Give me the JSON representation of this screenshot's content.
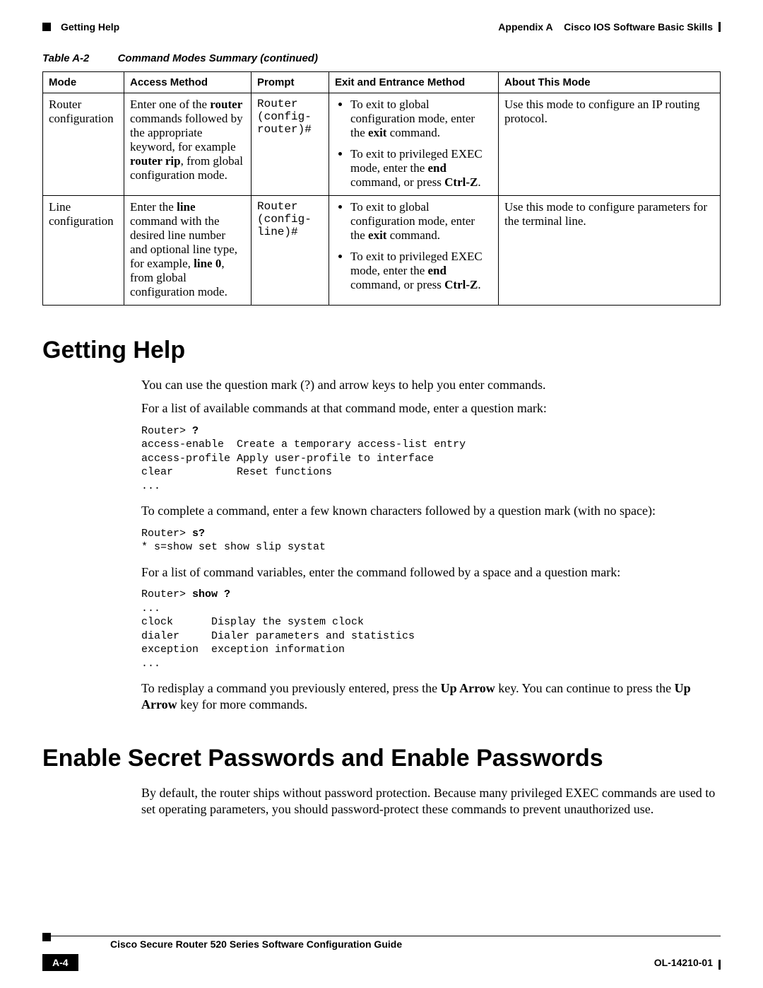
{
  "header": {
    "section_title": "Getting Help",
    "appendix_label": "Appendix A",
    "appendix_title": "Cisco IOS Software Basic Skills"
  },
  "table": {
    "label": "Table A-2",
    "caption": "Command Modes Summary (continued)",
    "headers": {
      "mode": "Mode",
      "access": "Access Method",
      "prompt": "Prompt",
      "exit": "Exit and Entrance Method",
      "about": "About This Mode"
    },
    "rows": [
      {
        "mode": "Router configuration",
        "access_pre": "Enter one of the ",
        "access_b1": "router",
        "access_mid": " commands followed by the appropriate keyword, for example ",
        "access_b2": "router rip",
        "access_post": ", from global configuration mode.",
        "prompt": "Router\n(config-\nrouter)#",
        "exit_li1_pre": "To exit to global configuration mode, enter the ",
        "exit_li1_b": "exit",
        "exit_li1_post": " command.",
        "exit_li2_pre": "To exit to privileged EXEC mode, enter the ",
        "exit_li2_b": "end",
        "exit_li2_mid": " command, or press ",
        "exit_li2_b2": "Ctrl-Z",
        "exit_li2_post": ".",
        "about": "Use this mode to configure an IP routing protocol."
      },
      {
        "mode": "Line configuration",
        "access_pre": "Enter the ",
        "access_b1": "line",
        "access_mid": " command with the desired line number and optional line type, for example, ",
        "access_b2": "line 0",
        "access_post": ", from global configuration mode.",
        "prompt": "Router\n(config-\nline)#",
        "exit_li1_pre": "To exit to global configuration mode, enter the ",
        "exit_li1_b": "exit",
        "exit_li1_post": " command.",
        "exit_li2_pre": "To exit to privileged EXEC mode, enter the ",
        "exit_li2_b": "end",
        "exit_li2_mid": " command, or press ",
        "exit_li2_b2": "Ctrl-Z",
        "exit_li2_post": ".",
        "about": "Use this mode to configure parameters for the terminal line."
      }
    ]
  },
  "sections": {
    "getting_help": {
      "title": "Getting Help",
      "p1": "You can use the question mark (?) and arrow keys to help you enter commands.",
      "p2": "For a list of available commands at that command mode, enter a question mark:",
      "code1_prefix": "Router> ",
      "code1_cmd": "?",
      "code1_body": "access-enable  Create a temporary access-list entry\naccess-profile Apply user-profile to interface\nclear          Reset functions\n...",
      "p3": "To complete a command, enter a few known characters followed by a question mark (with no space):",
      "code2_prefix": "Router> ",
      "code2_cmd": "s?",
      "code2_body": "* s=show set show slip systat",
      "p4": "For a list of command variables, enter the command followed by a space and a question mark:",
      "code3_prefix": "Router> ",
      "code3_cmd": "show ?",
      "code3_body": "...\nclock      Display the system clock\ndialer     Dialer parameters and statistics\nexception  exception information\n...",
      "p5_pre": "To redisplay a command you previously entered, press the ",
      "p5_b1": "Up Arrow",
      "p5_mid": " key. You can continue to press the ",
      "p5_b2": "Up Arrow",
      "p5_post": " key for more commands."
    },
    "enable_passwords": {
      "title": "Enable Secret Passwords and Enable Passwords",
      "p1": "By default, the router ships without password protection. Because many privileged EXEC commands are used to set operating parameters, you should password-protect these commands to prevent unauthorized use."
    }
  },
  "footer": {
    "guide_title": "Cisco Secure Router 520 Series Software Configuration Guide",
    "page_number": "A-4",
    "doc_number": "OL-14210-01"
  }
}
